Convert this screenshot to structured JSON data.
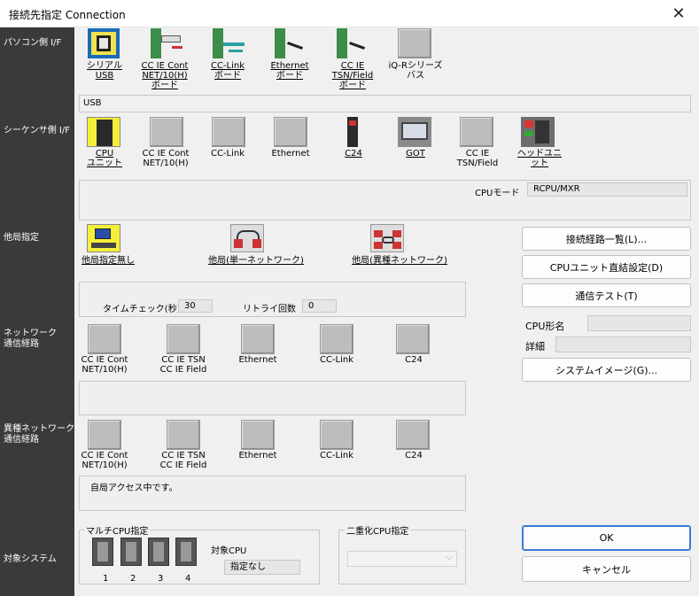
{
  "window": {
    "title": "接続先指定 Connection",
    "close_icon": "close-icon"
  },
  "side": {
    "pc_if": "パソコン側 I/F",
    "plc_if": "シーケンサ側 I/F",
    "other_station": "他局指定",
    "network_route": "ネットワーク\n通信経路",
    "hetero_route": "異種ネットワーク\n通信経路",
    "target_system": "対象システム"
  },
  "pc_side": {
    "items": [
      {
        "label": "シリアル\nUSB"
      },
      {
        "label": "CC IE Cont\nNET/10(H)\nボード"
      },
      {
        "label": "CC-Link\nボード"
      },
      {
        "label": "Ethernet\nボード"
      },
      {
        "label": "CC IE\nTSN/Field\nボード"
      },
      {
        "label": "iQ-Rシリーズ\nバス"
      }
    ],
    "selected_text": "USB"
  },
  "plc_side": {
    "items": [
      {
        "label": "CPU\nユニット"
      },
      {
        "label": "CC IE Cont\nNET/10(H)"
      },
      {
        "label": "CC-Link"
      },
      {
        "label": "Ethernet"
      },
      {
        "label": "C24"
      },
      {
        "label": "GOT"
      },
      {
        "label": "CC IE\nTSN/Field"
      },
      {
        "label": "ヘッドユニット"
      }
    ],
    "cpu_mode_label": "CPUモード",
    "cpu_mode_value": "RCPU/MXR"
  },
  "other": {
    "items": [
      {
        "label": "他局指定無し"
      },
      {
        "label": "他局(単一ネットワーク)"
      },
      {
        "label": "他局(異種ネットワーク)"
      }
    ]
  },
  "timing": {
    "time_check_label": "タイムチェック(秒)",
    "time_check_value": "30",
    "retry_label": "リトライ回数",
    "retry_value": "0"
  },
  "network": {
    "items": [
      {
        "label": "CC IE Cont\nNET/10(H)"
      },
      {
        "label": "CC IE TSN\nCC IE Field"
      },
      {
        "label": "Ethernet"
      },
      {
        "label": "CC-Link"
      },
      {
        "label": "C24"
      }
    ]
  },
  "hetero": {
    "items": [
      {
        "label": "CC IE Cont\nNET/10(H)"
      },
      {
        "label": "CC IE TSN\nCC IE Field"
      },
      {
        "label": "Ethernet"
      },
      {
        "label": "CC-Link"
      },
      {
        "label": "C24"
      }
    ]
  },
  "status_message": "自局アクセス中です。",
  "buttons": {
    "route_list": "接続経路一覧(L)...",
    "cpu_direct": "CPUユニット直結設定(D)",
    "comm_test": "通信テスト(T)",
    "system_image": "システムイメージ(G)...",
    "ok": "OK",
    "cancel": "キャンセル"
  },
  "cpu_info": {
    "model_label": "CPU形名",
    "model_value": "",
    "detail_label": "詳細",
    "detail_value": ""
  },
  "multi_cpu": {
    "title": "マルチCPU指定",
    "numbers": [
      "1",
      "2",
      "3",
      "4"
    ],
    "target_label": "対象CPU",
    "target_value": "指定なし"
  },
  "redundant": {
    "title": "二重化CPU指定",
    "selected": ""
  }
}
